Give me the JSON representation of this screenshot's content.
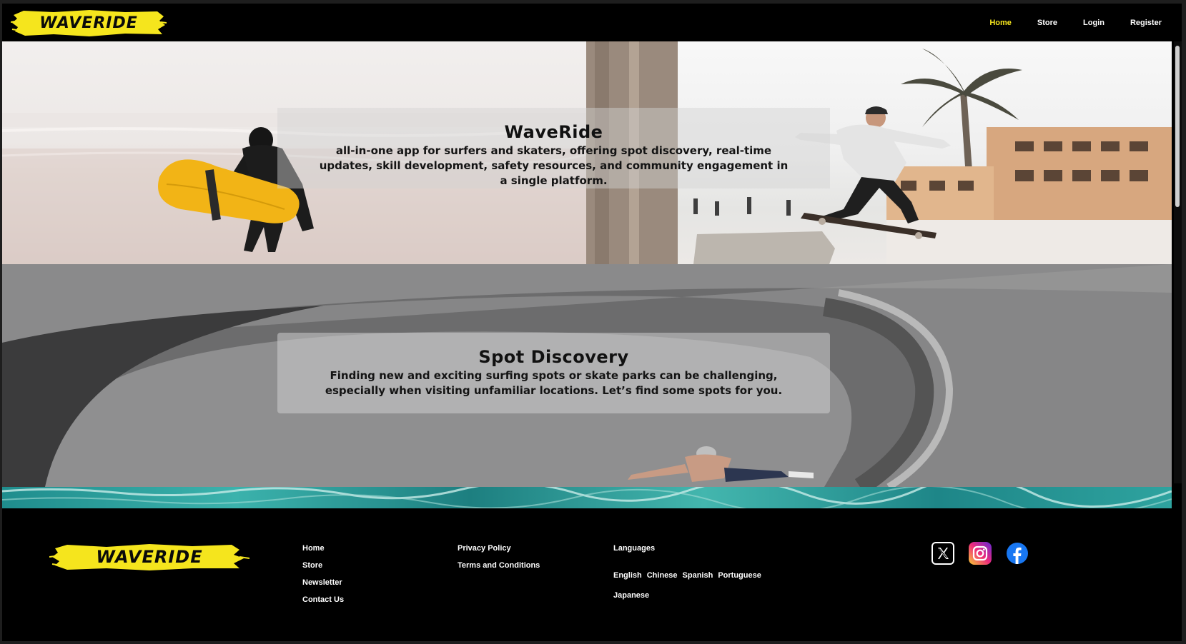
{
  "header": {
    "logo_text": "WAVERIDE",
    "nav": [
      {
        "label": "Home",
        "active": true
      },
      {
        "label": "Store",
        "active": false
      },
      {
        "label": "Login",
        "active": false
      },
      {
        "label": "Register",
        "active": false
      }
    ]
  },
  "hero": {
    "title": "WaveRide",
    "description": "all-in-one app for surfers and skaters, offering spot discovery, real-time updates, skill development, safety resources, and community engagement in a single platform."
  },
  "spot_discovery": {
    "title": "Spot Discovery",
    "description": "Finding new and exciting surfing spots or skate parks can be challenging, especially when visiting unfamiliar locations. Let’s find some spots for you."
  },
  "footer": {
    "logo_text": "WAVERIDE",
    "links_col1": [
      "Home",
      "Store",
      "Newsletter",
      "Contact Us"
    ],
    "links_col2": [
      "Privacy Policy",
      "Terms and Conditions"
    ],
    "languages_heading": "Languages",
    "languages": [
      "English",
      "Chinese",
      "Spanish",
      "Portuguese",
      "Japanese"
    ],
    "social": [
      "x-icon",
      "instagram-icon",
      "facebook-icon"
    ]
  },
  "colors": {
    "brand_yellow": "#f5e51d",
    "background": "#000000",
    "nav_active": "#f5e51d"
  }
}
